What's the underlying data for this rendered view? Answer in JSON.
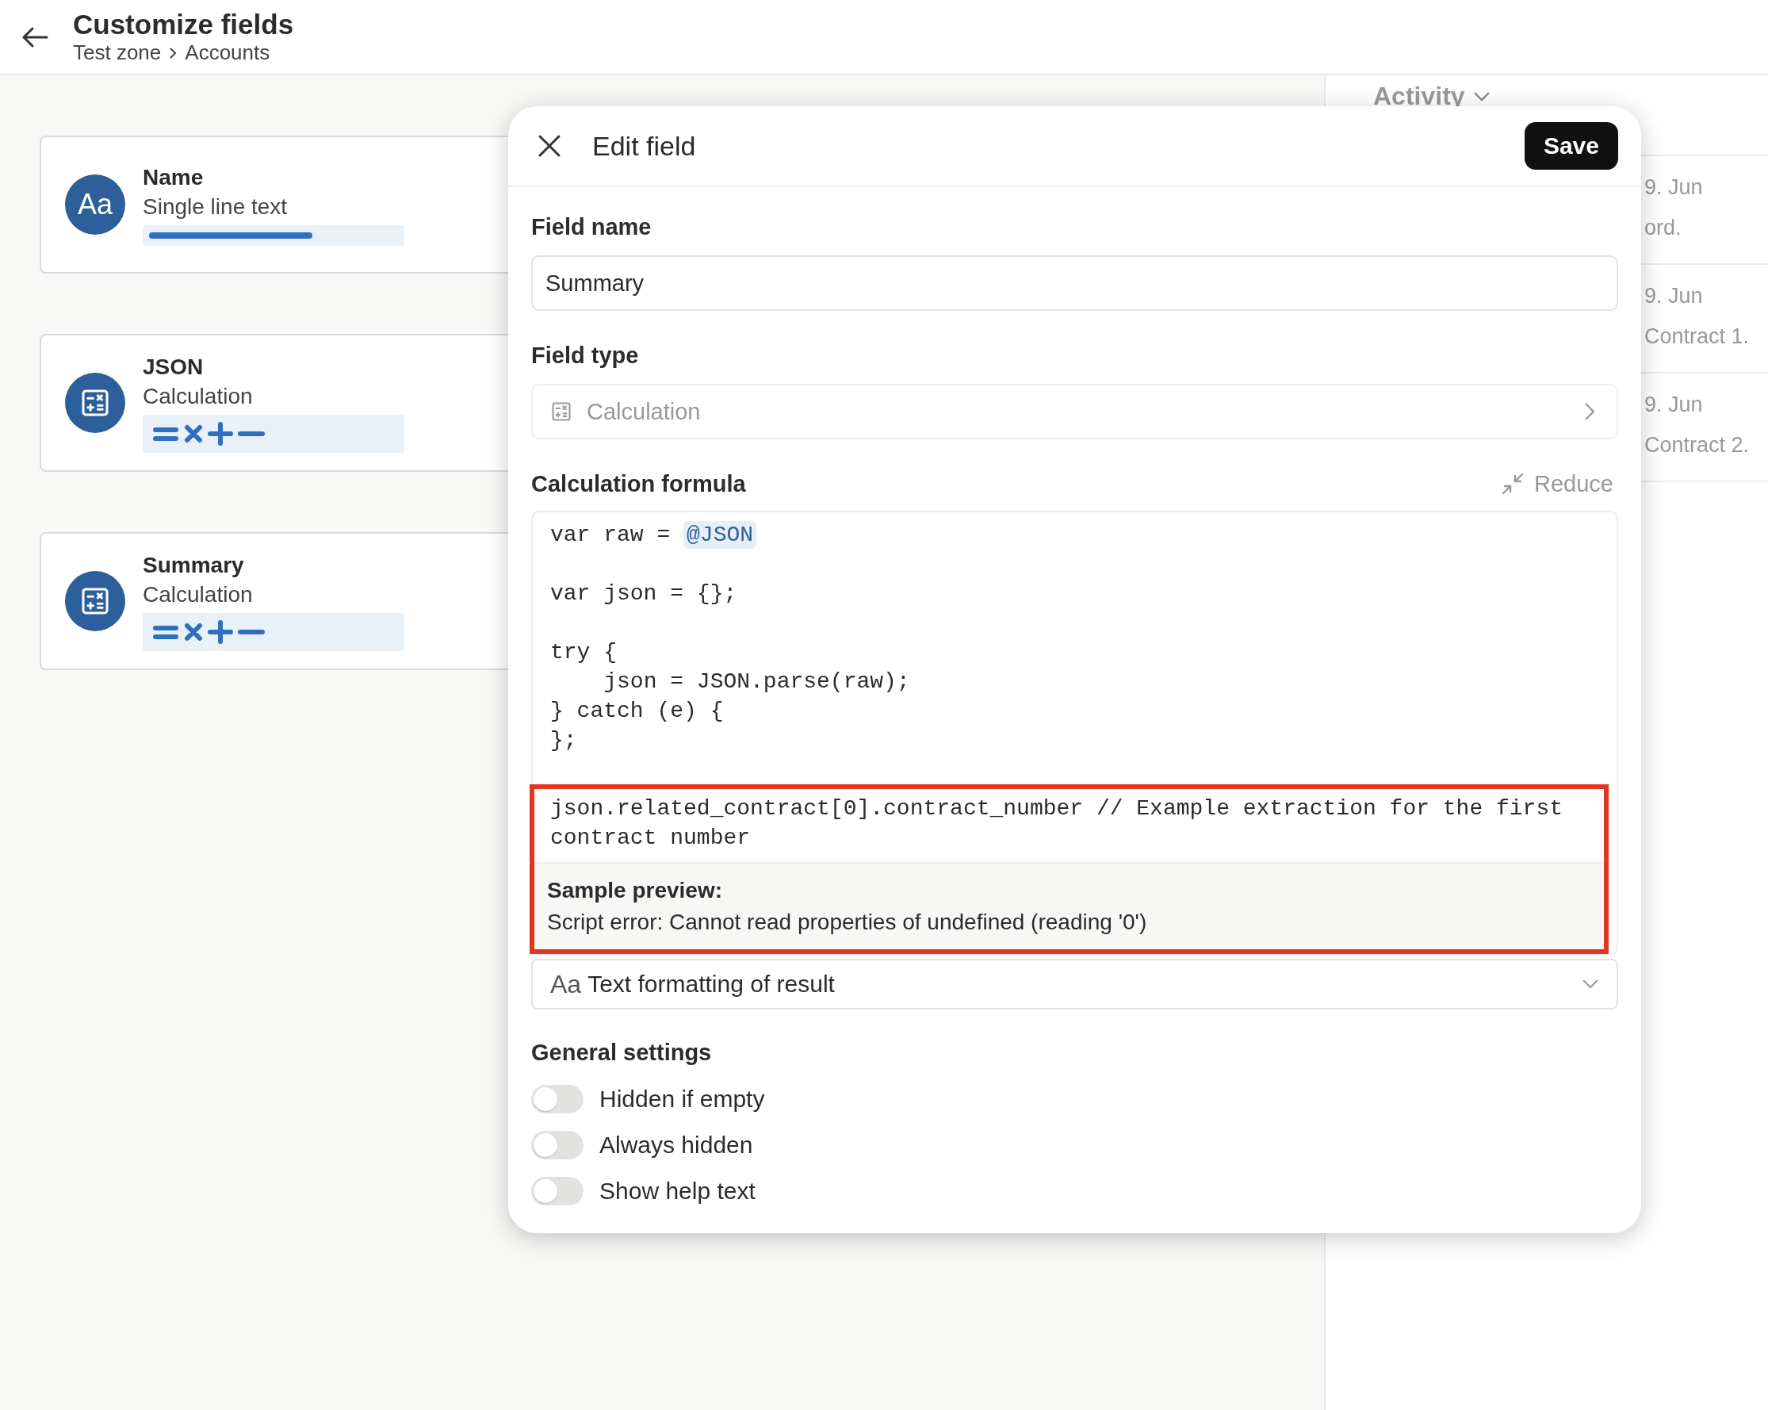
{
  "header": {
    "title": "Customize fields",
    "breadcrumb": [
      "Test zone",
      "Accounts"
    ]
  },
  "fields": [
    {
      "name": "Name",
      "type_label": "Single line text",
      "kind": "text",
      "icon_text": "Aa"
    },
    {
      "name": "JSON",
      "type_label": "Calculation",
      "kind": "calculation"
    },
    {
      "name": "Summary",
      "type_label": "Calculation",
      "kind": "calculation"
    }
  ],
  "activity": {
    "title": "Activity",
    "entries": [
      {
        "date": "9. Jun",
        "text": "ord."
      },
      {
        "date": "9. Jun",
        "text": "Contract 1."
      },
      {
        "date": "9. Jun",
        "text": "Contract 2."
      }
    ]
  },
  "dialog": {
    "title": "Edit field",
    "save": "Save",
    "field_name": {
      "label": "Field name",
      "value": "Summary"
    },
    "field_type": {
      "label": "Field type",
      "value": "Calculation"
    },
    "formula": {
      "label": "Calculation formula",
      "reduce": "Reduce",
      "highlighted": true,
      "blocks": [
        [
          {
            "text": "var raw = ",
            "reference": "@JSON"
          }
        ],
        [
          {
            "text": "var json = {};"
          }
        ],
        [
          {
            "text": "try {"
          },
          {
            "text": "    json = JSON.parse(raw);"
          },
          {
            "text": "} catch (e) {"
          },
          {
            "text": "};"
          }
        ],
        [
          {
            "text": "json.related_contract[0].contract_number // Example extraction for the first contract number"
          }
        ]
      ],
      "preview_label": "Sample preview:",
      "preview_text": "Script error: Cannot read properties of undefined (reading '0')"
    },
    "formatting": {
      "icon_text": "Aa",
      "label": "Text formatting of result"
    },
    "general": {
      "label": "General settings",
      "toggles": [
        {
          "label": "Hidden if empty",
          "on": false
        },
        {
          "label": "Always hidden",
          "on": false
        },
        {
          "label": "Show help text",
          "on": false
        }
      ]
    }
  }
}
